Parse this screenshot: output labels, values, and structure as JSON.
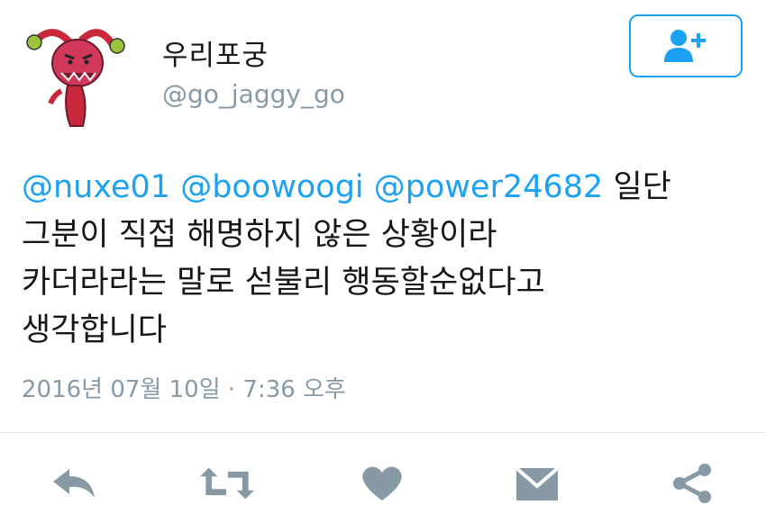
{
  "user": {
    "display_name": "우리포궁",
    "handle": "@go_jaggy_go",
    "avatar_icon": "jester-avatar-icon",
    "follow_icon": "follow-user-plus-icon"
  },
  "tweet": {
    "mentions": [
      "@nuxe01",
      "@boowoogi",
      "@power24682"
    ],
    "line1_text": "일단",
    "line2": "그분이 직접 해명하지 않은 상황이라",
    "line3": "카더라라는 말로 섣불리 행동할순없다고",
    "line4": "생각합니다",
    "timestamp": "2016년 07월 10일 · 7:36 오후"
  },
  "actions": [
    {
      "icon": "reply-icon"
    },
    {
      "icon": "retweet-icon"
    },
    {
      "icon": "like-heart-icon"
    },
    {
      "icon": "message-envelope-icon"
    },
    {
      "icon": "share-icon"
    }
  ],
  "colors": {
    "accent": "#1da1f2",
    "text": "#14171a",
    "secondary": "#8899a6",
    "icon_gray": "#8899a6",
    "divider": "#e1e8ed"
  }
}
